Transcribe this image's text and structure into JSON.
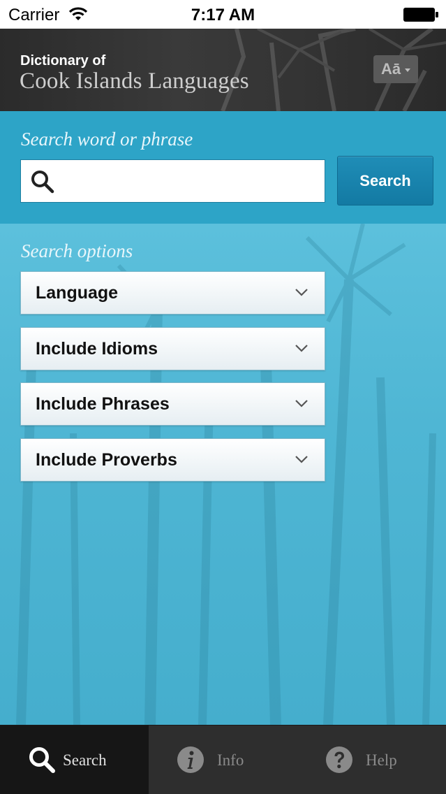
{
  "status_bar": {
    "carrier": "Carrier",
    "time": "7:17 AM"
  },
  "header": {
    "title_small": "Dictionary of",
    "title_big": "Cook Islands Languages",
    "font_button_label": "Aā"
  },
  "search": {
    "label": "Search word or phrase",
    "input_value": "",
    "placeholder": "",
    "button_label": "Search"
  },
  "options": {
    "label": "Search options",
    "items": [
      {
        "label": "Language"
      },
      {
        "label": "Include Idioms"
      },
      {
        "label": "Include Phrases"
      },
      {
        "label": "Include Proverbs"
      }
    ]
  },
  "tab_bar": {
    "tabs": [
      {
        "label": "Search",
        "icon": "search-icon",
        "active": true
      },
      {
        "label": "Info",
        "icon": "info-icon",
        "active": false
      },
      {
        "label": "Help",
        "icon": "help-icon",
        "active": false
      }
    ]
  },
  "colors": {
    "search_panel": "#2da4c7",
    "search_button": "#137aa3",
    "header_bg": "#333333",
    "tab_bar_bg": "#2e2e2e"
  }
}
